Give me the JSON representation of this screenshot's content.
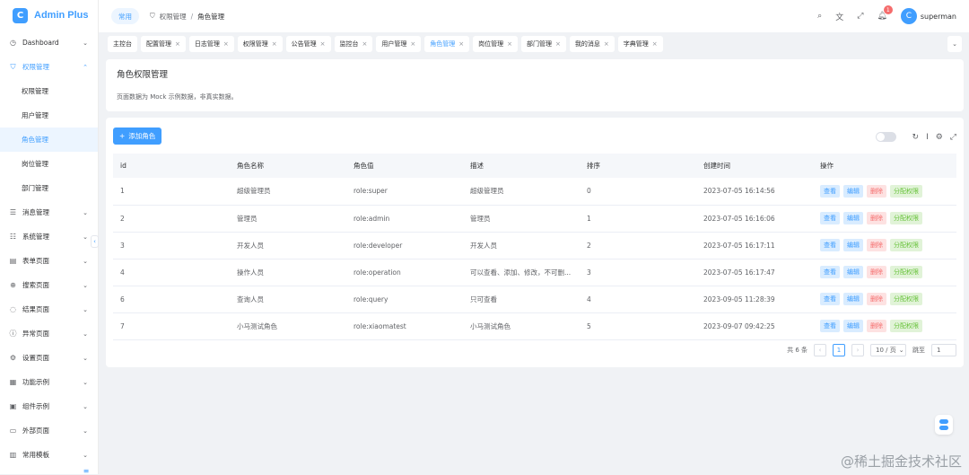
{
  "app": {
    "title": "Admin Plus"
  },
  "sidebar": {
    "items": [
      {
        "label": "Dashboard",
        "icon": "dashboard-icon"
      },
      {
        "label": "权限管理",
        "icon": "shield-icon"
      },
      {
        "label": "权限管理"
      },
      {
        "label": "用户管理"
      },
      {
        "label": "角色管理"
      },
      {
        "label": "岗位管理"
      },
      {
        "label": "部门管理"
      },
      {
        "label": "消息管理",
        "icon": "list-icon"
      },
      {
        "label": "系统管理",
        "icon": "settings-icon"
      },
      {
        "label": "表单页面",
        "icon": "form-icon"
      },
      {
        "label": "搜索页面",
        "icon": "search-icon"
      },
      {
        "label": "结果页面",
        "icon": "check-circle-icon"
      },
      {
        "label": "异常页面",
        "icon": "warning-icon"
      },
      {
        "label": "设置页面",
        "icon": "gear-icon"
      },
      {
        "label": "功能示例",
        "icon": "grid-icon"
      },
      {
        "label": "组件示例",
        "icon": "component-icon"
      },
      {
        "label": "外部页面",
        "icon": "monitor-icon"
      },
      {
        "label": "常用模板",
        "icon": "template-icon"
      }
    ]
  },
  "header": {
    "tag": "常用",
    "breadcrumb": [
      "权限管理",
      "角色管理"
    ],
    "notification_count": "1",
    "username": "superman"
  },
  "tabs": [
    {
      "label": "主控台",
      "closable": false
    },
    {
      "label": "配置管理",
      "closable": true
    },
    {
      "label": "日志管理",
      "closable": true
    },
    {
      "label": "权限管理",
      "closable": true
    },
    {
      "label": "公告管理",
      "closable": true
    },
    {
      "label": "监控台",
      "closable": true
    },
    {
      "label": "用户管理",
      "closable": true
    },
    {
      "label": "角色管理",
      "closable": true
    },
    {
      "label": "岗位管理",
      "closable": true
    },
    {
      "label": "部门管理",
      "closable": true
    },
    {
      "label": "我的消息",
      "closable": true
    },
    {
      "label": "字典管理",
      "closable": true
    }
  ],
  "page": {
    "title": "角色权限管理",
    "description": "页面数据为 Mock 示例数据，非真实数据。"
  },
  "toolbar": {
    "add_label": "添加角色"
  },
  "table": {
    "headers": [
      "id",
      "角色名称",
      "角色值",
      "描述",
      "排序",
      "创建时间",
      "操作"
    ],
    "rows": [
      [
        "1",
        "超级管理员",
        "role:super",
        "超级管理员",
        "0",
        "2023-07-05 16:14:56"
      ],
      [
        "2",
        "管理员",
        "role:admin",
        "管理员",
        "1",
        "2023-07-05 16:16:06"
      ],
      [
        "3",
        "开发人员",
        "role:developer",
        "开发人员",
        "2",
        "2023-07-05 16:17:11"
      ],
      [
        "4",
        "操作人员",
        "role:operation",
        "可以查看、添加、修改，不可删...",
        "3",
        "2023-07-05 16:17:47"
      ],
      [
        "6",
        "查询人员",
        "role:query",
        "只可查看",
        "4",
        "2023-09-05 11:28:39"
      ],
      [
        "7",
        "小马测试角色",
        "role:xiaomatest",
        "小马测试角色",
        "5",
        "2023-09-07 09:42:25"
      ]
    ],
    "actions": [
      "查看",
      "编辑",
      "删除",
      "分配权限"
    ]
  },
  "pagination": {
    "total_text": "共 6 条",
    "current_page": "1",
    "page_size": "10 / 页",
    "jump_label": "跳至",
    "jump_value": "1"
  },
  "watermark": "@稀土掘金技术社区",
  "colors": {
    "primary": "#409eff",
    "danger": "#f56c6c",
    "success": "#67c23a"
  }
}
